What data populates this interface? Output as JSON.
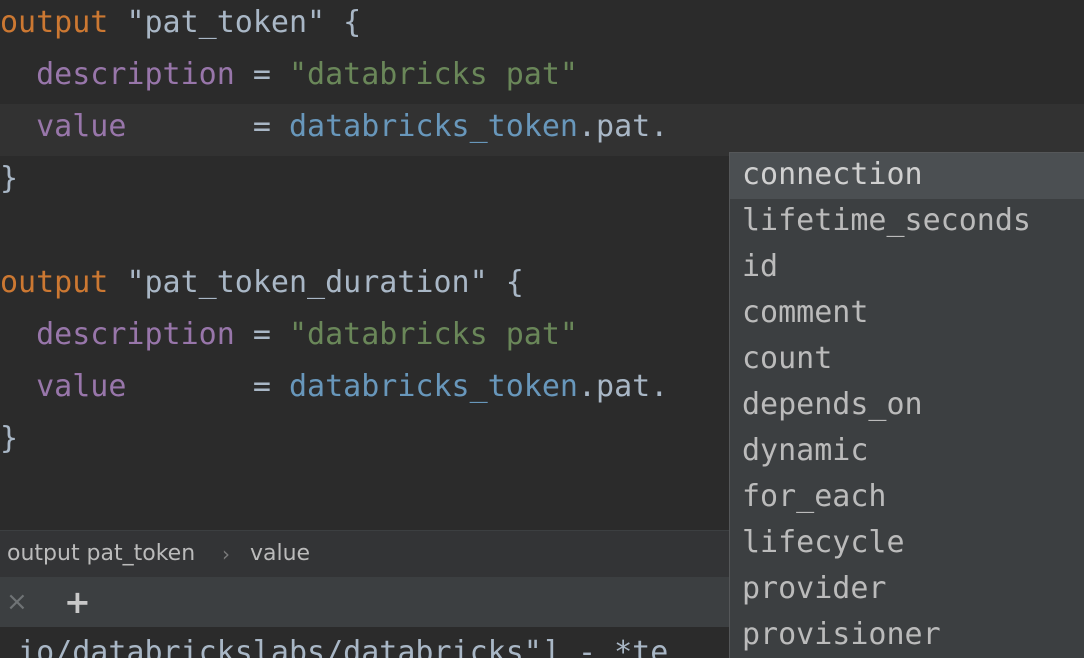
{
  "editor": {
    "lines": [
      {
        "tokens": [
          {
            "text": "output",
            "cls": "kw"
          },
          {
            "text": " ",
            "cls": "plain"
          },
          {
            "text": "\"pat_token\"",
            "cls": "plain"
          },
          {
            "text": " {",
            "cls": "plain"
          }
        ]
      },
      {
        "tokens": [
          {
            "text": "  ",
            "cls": "plain"
          },
          {
            "text": "description",
            "cls": "attr"
          },
          {
            "text": " = ",
            "cls": "plain"
          },
          {
            "text": "\"databricks pat\"",
            "cls": "str"
          }
        ]
      },
      {
        "tokens": [
          {
            "text": "  ",
            "cls": "plain"
          },
          {
            "text": "value",
            "cls": "attr"
          },
          {
            "text": "       = ",
            "cls": "plain"
          },
          {
            "text": "databricks_token",
            "cls": "ref"
          },
          {
            "text": ".pat.",
            "cls": "plain"
          }
        ]
      },
      {
        "tokens": [
          {
            "text": "}",
            "cls": "plain"
          }
        ]
      },
      {
        "tokens": []
      },
      {
        "tokens": [
          {
            "text": "output",
            "cls": "kw"
          },
          {
            "text": " ",
            "cls": "plain"
          },
          {
            "text": "\"pat_token_duration\"",
            "cls": "plain"
          },
          {
            "text": " {",
            "cls": "plain"
          }
        ]
      },
      {
        "tokens": [
          {
            "text": "  ",
            "cls": "plain"
          },
          {
            "text": "description",
            "cls": "attr"
          },
          {
            "text": " = ",
            "cls": "plain"
          },
          {
            "text": "\"databricks pat\"",
            "cls": "str"
          }
        ]
      },
      {
        "tokens": [
          {
            "text": "  ",
            "cls": "plain"
          },
          {
            "text": "value",
            "cls": "attr"
          },
          {
            "text": "       = ",
            "cls": "plain"
          },
          {
            "text": "databricks_token",
            "cls": "ref"
          },
          {
            "text": ".pat.",
            "cls": "plain"
          }
        ]
      },
      {
        "tokens": [
          {
            "text": "}",
            "cls": "plain"
          }
        ]
      }
    ],
    "current_line": 2
  },
  "breadcrumb": {
    "items": [
      "output pat_token",
      "value"
    ],
    "separator": "›"
  },
  "terminal": {
    "close_icon": "×",
    "add_icon": "+",
    "output_text": " io/databrickslabs/databricks\"] - *te"
  },
  "completion": {
    "items": [
      "connection",
      "lifetime_seconds",
      "id",
      "comment",
      "count",
      "depends_on",
      "dynamic",
      "for_each",
      "lifecycle",
      "provider",
      "provisioner"
    ],
    "selected": 0
  }
}
